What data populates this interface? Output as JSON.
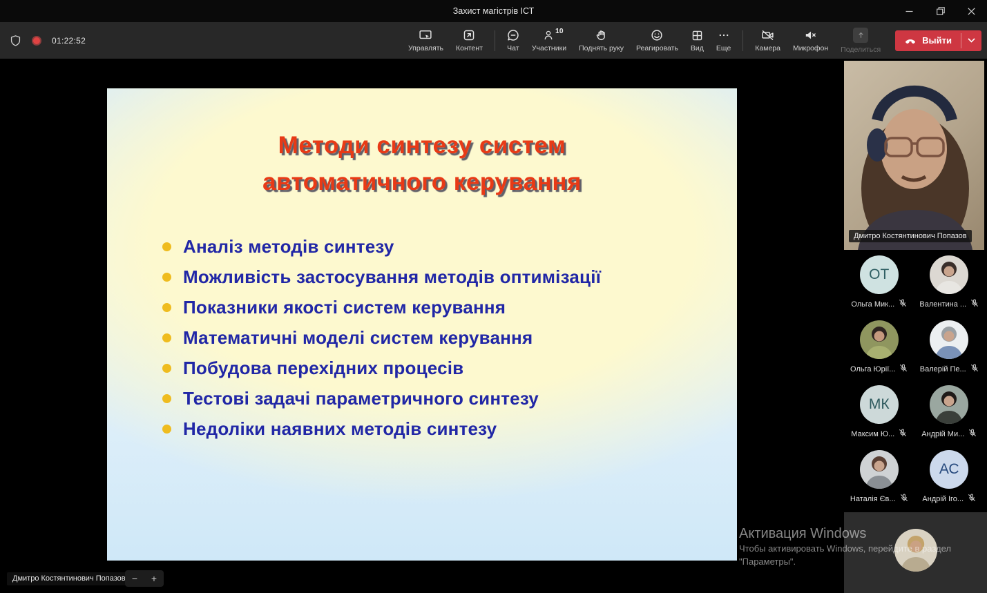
{
  "window": {
    "title": "Захист магістрів ІСТ"
  },
  "toolbar": {
    "timer": "01:22:52",
    "manage": "Управлять",
    "content": "Контент",
    "chat": "Чат",
    "participants": "Участники",
    "participants_count": "10",
    "raise_hand": "Поднять руку",
    "react": "Реагировать",
    "view": "Вид",
    "more": "Еще",
    "camera": "Камера",
    "microphone": "Микрофон",
    "share": "Поделиться",
    "leave": "Выйти"
  },
  "slide": {
    "title_line1": "Методи синтезу систем",
    "title_line2": "автоматичного керування",
    "bullets": [
      "Аналіз методів синтезу",
      "Можливість застосування методів оптимізації",
      "Показники якості систем керування",
      "Математичні моделі систем керування",
      "Побудова перехідних процесів",
      "Тестові задачі параметричного синтезу",
      "Недоліки наявних методів синтезу"
    ]
  },
  "presenter": {
    "name": "Дмитро Костянтинович Попазов"
  },
  "participants": [
    {
      "name": "Ольга Мик...",
      "initials": "ОТ",
      "type": "initials"
    },
    {
      "name": "Валентина ...",
      "type": "photo"
    },
    {
      "name": "Ольга Юрії...",
      "type": "photo"
    },
    {
      "name": "Валерій Пе...",
      "type": "photo"
    },
    {
      "name": "Максим Ю...",
      "initials": "МК",
      "type": "initials"
    },
    {
      "name": "Андрій Ми...",
      "type": "photo"
    },
    {
      "name": "Наталія Єв...",
      "type": "photo"
    },
    {
      "name": "Андрій Іго...",
      "initials": "АС",
      "type": "initials"
    }
  ],
  "footer": {
    "presenter_label": "Дмитро Костянтинович Попазов",
    "zoom_out": "−",
    "zoom_in": "+"
  },
  "watermark": {
    "line1": "Активация Windows",
    "line2": "Чтобы активировать Windows, перейдите в раздел",
    "line3": "\"Параметры\"."
  },
  "colors": {
    "leave_button": "#ce3742",
    "record_indicator": "#e04343",
    "slide_title": "#e83a16",
    "bullet_text": "#2127a6",
    "bullet_dot": "#efbc1e",
    "toolbar_bg": "#282828"
  }
}
